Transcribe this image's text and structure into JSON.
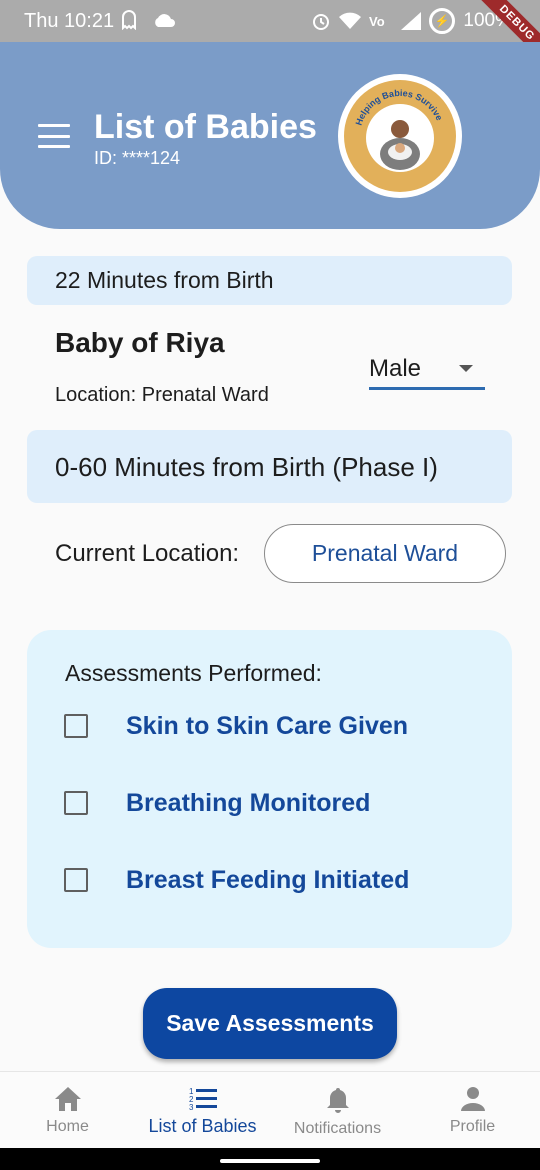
{
  "status_bar": {
    "time": "Thu 10:21",
    "battery": "100%",
    "debug": "DEBUG"
  },
  "header": {
    "title": "List of Babies",
    "id": "ID: ****124",
    "logo_text": "Helping Babies Survive"
  },
  "time_from_birth": "22 Minutes from Birth",
  "baby": {
    "name": "Baby of Riya",
    "location": "Location: Prenatal Ward",
    "gender": "Male"
  },
  "phase": "0-60 Minutes from Birth (Phase I)",
  "current_location": {
    "label": "Current Location:",
    "value": "Prenatal Ward"
  },
  "assessments": {
    "title": "Assessments Performed:",
    "items": [
      {
        "label": "Skin to Skin Care Given",
        "checked": false
      },
      {
        "label": "Breathing Monitored",
        "checked": false
      },
      {
        "label": "Breast Feeding Initiated",
        "checked": false
      }
    ]
  },
  "save_button": "Save Assessments",
  "bottom_nav": {
    "items": [
      {
        "label": "Home",
        "icon": "home-icon",
        "active": false
      },
      {
        "label": "List of Babies",
        "icon": "list-icon",
        "active": true
      },
      {
        "label": "Notifications",
        "icon": "bell-icon",
        "active": false
      },
      {
        "label": "Profile",
        "icon": "person-icon",
        "active": false
      }
    ]
  },
  "colors": {
    "header": "#7b9cc8",
    "accent": "#0d47a1",
    "card": "#dfeefb",
    "assessment_card": "#e1f4fd",
    "label_blue": "#14489a"
  }
}
